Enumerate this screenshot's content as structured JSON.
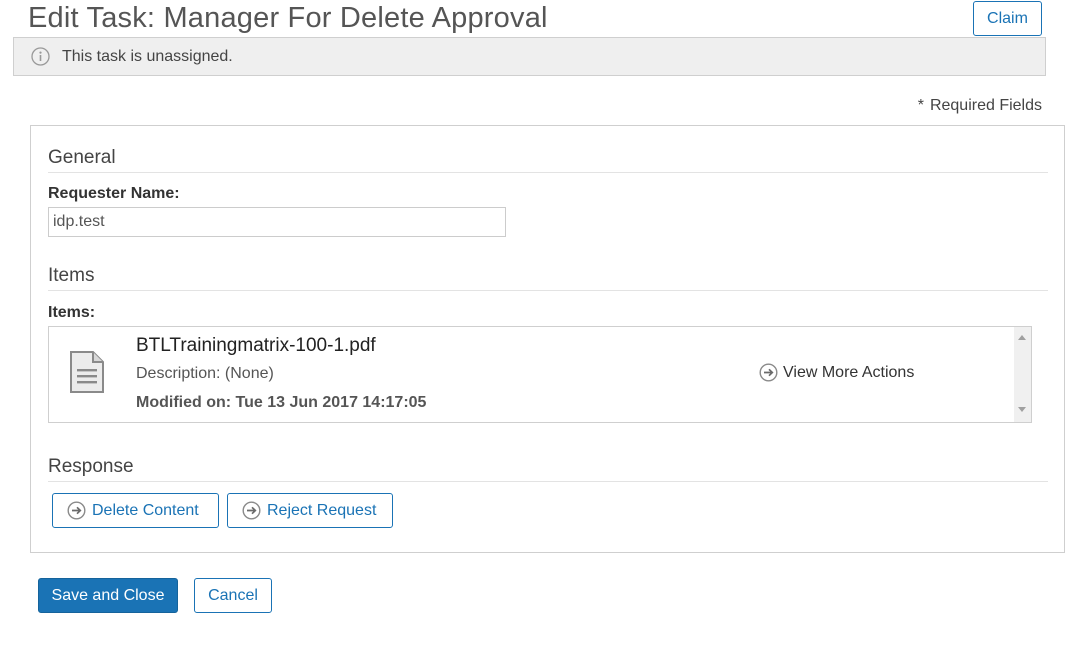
{
  "page": {
    "title": "Edit Task: Manager For Delete Approval",
    "claim_label": "Claim"
  },
  "notice": {
    "icon": "info-icon",
    "text": "This task is unassigned."
  },
  "required": {
    "star": "*",
    "text": "Required Fields"
  },
  "general": {
    "section_title": "General",
    "requester_label": "Requester Name:",
    "requester_value": "idp.test"
  },
  "items": {
    "section_title": "Items",
    "field_label": "Items:",
    "list": [
      {
        "icon": "document-icon",
        "name": "BTLTrainingmatrix-100-1.pdf",
        "description": "Description: (None)",
        "modified": "Modified on: Tue 13 Jun 2017 14:17:05",
        "action_label": "View More Actions"
      }
    ]
  },
  "response": {
    "section_title": "Response",
    "buttons": [
      {
        "label": "Delete Content",
        "icon": "arrow-circle-icon"
      },
      {
        "label": "Reject Request",
        "icon": "arrow-circle-icon"
      }
    ]
  },
  "footer": {
    "save_label": "Save and Close",
    "cancel_label": "Cancel"
  },
  "colors": {
    "accent": "#1a73b5",
    "notice_bg": "#efefef"
  }
}
